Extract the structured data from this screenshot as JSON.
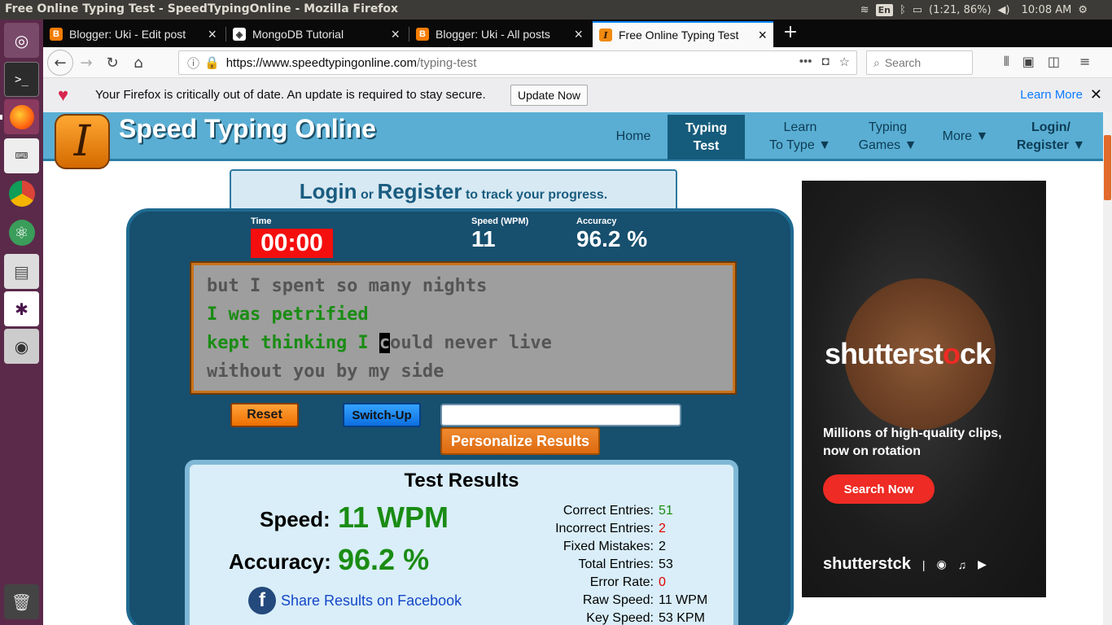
{
  "os": {
    "window_title": "Free Online Typing Test - SpeedTypingOnline - Mozilla Firefox",
    "tray_lang": "En",
    "battery": "(1:21, 86%)",
    "clock": "10:08 AM"
  },
  "browser": {
    "tabs": [
      {
        "label": "Blogger: Uki - Edit post"
      },
      {
        "label": "MongoDB Tutorial"
      },
      {
        "label": "Blogger: Uki - All posts"
      },
      {
        "label": "Free Online Typing Test"
      }
    ],
    "url_domain": "https://www.speedtypingonline.com",
    "url_path": "/typing-test",
    "search_placeholder": "Search"
  },
  "notification": {
    "message": "Your Firefox is critically out of date. An update is required to stay secure.",
    "update_button": "Update Now",
    "learn_more": "Learn More"
  },
  "site": {
    "name": "Speed Typing Online",
    "logo_letter": "I",
    "nav": {
      "home": "Home",
      "typing_test_1": "Typing",
      "typing_test_2": "Test",
      "learn_1": "Learn",
      "learn_2": "To Type",
      "games_1": "Typing",
      "games_2": "Games",
      "more": "More",
      "login_1": "Login/",
      "login_2": "Register",
      "arrow": "▼"
    },
    "loginbar": {
      "login": "Login",
      "or": "or",
      "register": "Register",
      "suffix": "to track your progress."
    }
  },
  "test": {
    "time_label": "Time",
    "time_value": "00:00",
    "speed_label": "Speed (WPM)",
    "speed_value": "11",
    "accuracy_label": "Accuracy",
    "accuracy_value": "96.2 %",
    "lines": {
      "l1": "but I spent so many nights",
      "l2": "I was petrified",
      "l3_done": "kept thinking I ",
      "l3_cursor": "c",
      "l3_rest": "ould never live",
      "l4": "without you by my side"
    },
    "reset": "Reset",
    "switch_up": "Switch-Up",
    "personalize": "Personalize Results"
  },
  "results": {
    "title": "Test Results",
    "speed_label": "Speed:",
    "speed_value": "11 WPM",
    "accuracy_label": "Accuracy:",
    "accuracy_value": "96.2 %",
    "details": [
      {
        "label": "Correct Entries:",
        "value": "51",
        "color": "#1a8c14"
      },
      {
        "label": "Incorrect Entries:",
        "value": "2",
        "color": "#e00000"
      },
      {
        "label": "Fixed Mistakes:",
        "value": "2",
        "color": "#000000"
      },
      {
        "label": "Total Entries:",
        "value": "53",
        "color": "#000000"
      },
      {
        "label": "Error Rate:",
        "value": "0",
        "color": "#e00000"
      },
      {
        "label": "Raw Speed:",
        "value": "11 WPM",
        "color": "#000000"
      },
      {
        "label": "Key Speed:",
        "value": "53 KPM",
        "color": "#000000"
      }
    ],
    "share_facebook": "Share Results on Facebook"
  },
  "ad": {
    "brand_a": "shutterst",
    "brand_b": "ck",
    "tagline": "Millions of high-quality clips, now on rotation",
    "cta": "Search Now",
    "footer_brand": "shutterstck"
  },
  "colors": {
    "accent_orange": "#e26a2c",
    "site_blue": "#5aaed3",
    "ad_red": "#ee2b24",
    "correct_green": "#1a8c14"
  }
}
